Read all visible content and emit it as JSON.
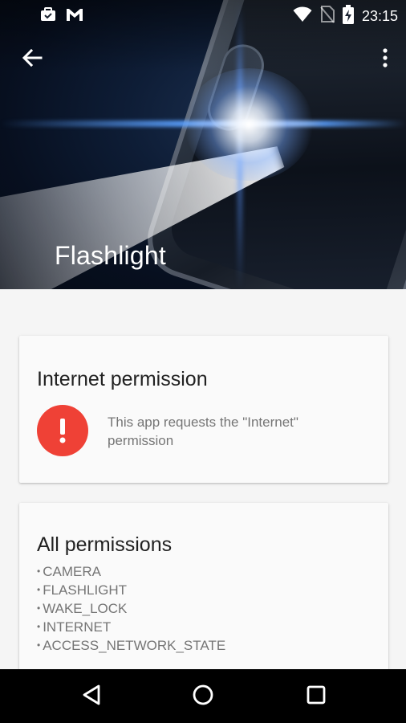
{
  "status_bar": {
    "time": "23:15",
    "left_icons": [
      "work-badge-icon",
      "gmail-icon"
    ],
    "right_icons": [
      "wifi-icon",
      "no-sim-icon",
      "battery-charging-icon"
    ]
  },
  "app_bar": {
    "back_icon": "arrow-back-icon",
    "menu_icon": "more-vert-icon",
    "title": "Flashlight"
  },
  "internet_card": {
    "title": "Internet permission",
    "icon": "alert-icon",
    "icon_color": "#ef4136",
    "description": "This app requests the \"Internet\" permission"
  },
  "permissions_card": {
    "title": "All permissions",
    "items": [
      "CAMERA",
      "FLASHLIGHT",
      "WAKE_LOCK",
      "INTERNET",
      "ACCESS_NETWORK_STATE"
    ]
  },
  "nav_bar": {
    "buttons": [
      "back-triangle-icon",
      "home-circle-icon",
      "recents-square-icon"
    ]
  }
}
